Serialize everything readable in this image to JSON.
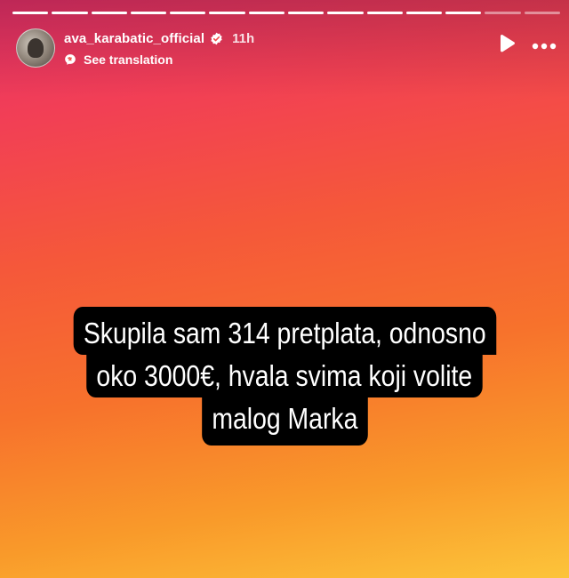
{
  "story": {
    "progress": {
      "total_segments": 14,
      "completed_segments": 12
    },
    "author": {
      "username": "ava_karabatic_official",
      "verified": true,
      "time_ago": "11h",
      "avatar_icon": "avatar-photo"
    },
    "translate": {
      "label": "See translation",
      "icon": "translate-icon"
    },
    "controls": {
      "play_icon": "play-icon",
      "more_icon": "more-options-icon"
    },
    "caption": {
      "lines": [
        "Skupila sam 314 pretplata, odnosno",
        "oko 3000€, hvala svima koji volite",
        "malog Marka"
      ]
    },
    "colors": {
      "gradient_top": "#e7306a",
      "gradient_middle": "#f7722c",
      "gradient_bottom": "#fcc43a",
      "caption_bg": "#000000",
      "text": "#ffffff"
    }
  }
}
